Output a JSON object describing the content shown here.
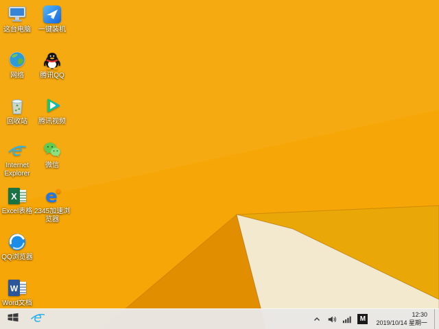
{
  "desktop": {
    "icons": [
      {
        "id": "this-pc",
        "label": "这台电脑"
      },
      {
        "id": "network",
        "label": "网络"
      },
      {
        "id": "recycle-bin",
        "label": "回收站"
      },
      {
        "id": "internet-explorer",
        "label": "Internet Explorer"
      },
      {
        "id": "excel",
        "label": "Excel表格"
      },
      {
        "id": "qq-browser",
        "label": "QQ浏览器"
      },
      {
        "id": "word",
        "label": "Word文档"
      },
      {
        "id": "one-key-install",
        "label": "一键装机"
      },
      {
        "id": "tencent-qq",
        "label": "腾讯QQ"
      },
      {
        "id": "tencent-video",
        "label": "腾讯视频"
      },
      {
        "id": "wechat",
        "label": "微信"
      },
      {
        "id": "browser-2345",
        "label": "2345加速浏览器"
      }
    ]
  },
  "taskbar": {
    "clock": {
      "time": "12:30",
      "date": "2019/10/14 星期一"
    },
    "tray": {
      "ime": "M"
    }
  },
  "wallpaper": {
    "orange": "#f6a606",
    "orange_deep": "#f09e00",
    "dark_orange": "#e18e00",
    "gold": "#e9a808",
    "cream": "#f3e9cf",
    "taskbar_bg": "#e9e7e4"
  }
}
